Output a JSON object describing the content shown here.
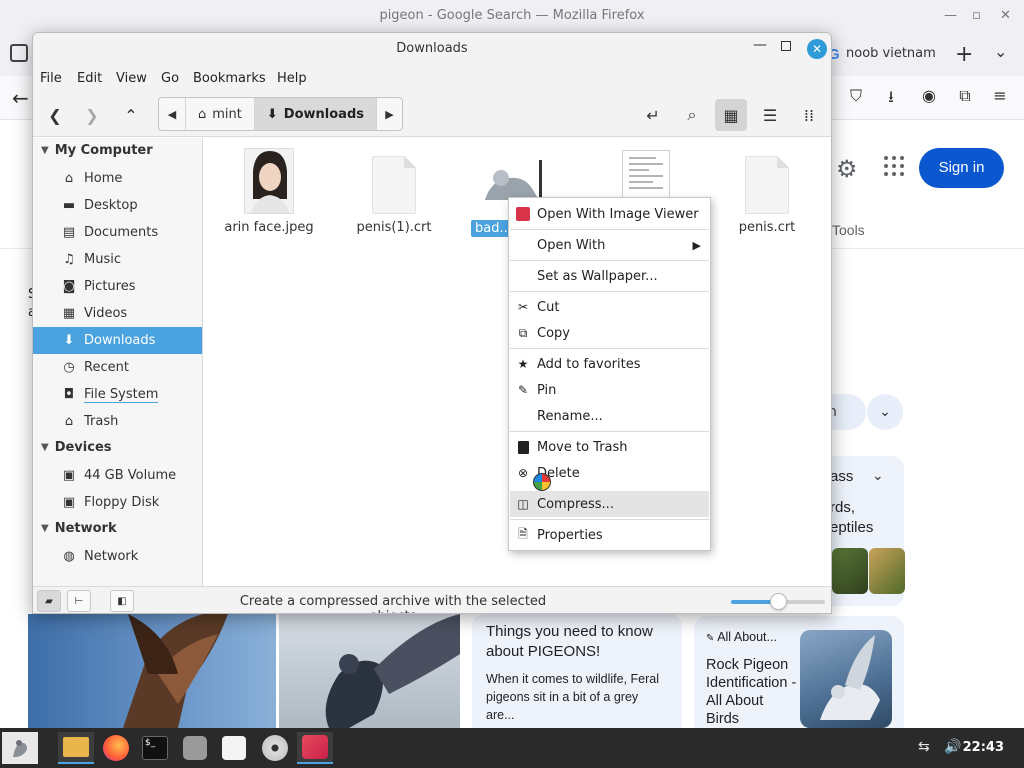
{
  "firefox": {
    "window_title": "pigeon - Google Search — Mozilla Firefox",
    "tab_label": "noob vietnam",
    "google": {
      "signin_label": "Sign in",
      "tools_label": "Tools",
      "chip_partial": "n",
      "panel_title_partial": "ass",
      "panel_text_partial_1": "rds,",
      "panel_text_partial_2": "eptiles",
      "left_partial_1": "S",
      "left_partial_2": "a",
      "card1_title": "Things you need to know about PIGEONS!",
      "card1_body": "When it comes to wildlife, Feral pigeons sit in a bit of a grey are...",
      "card2_source": "All About...",
      "card2_title": "Rock Pigeon Identification - All About Birds"
    }
  },
  "nemo": {
    "title": "Downloads",
    "menu": [
      "File",
      "Edit",
      "View",
      "Go",
      "Bookmarks",
      "Help"
    ],
    "path": {
      "home": "mint",
      "current": "Downloads"
    },
    "sidebar": {
      "sections": [
        {
          "header": "My Computer",
          "items": [
            {
              "label": "Home",
              "icon": "home-icon",
              "glyph": "⌂"
            },
            {
              "label": "Desktop",
              "icon": "desktop-icon",
              "glyph": "▬"
            },
            {
              "label": "Documents",
              "icon": "documents-icon",
              "glyph": "▤"
            },
            {
              "label": "Music",
              "icon": "music-icon",
              "glyph": "♫"
            },
            {
              "label": "Pictures",
              "icon": "camera-icon",
              "glyph": "◙"
            },
            {
              "label": "Videos",
              "icon": "film-icon",
              "glyph": "▦"
            },
            {
              "label": "Downloads",
              "icon": "download-icon",
              "glyph": "⬇"
            },
            {
              "label": "Recent",
              "icon": "clock-icon",
              "glyph": "◷"
            },
            {
              "label": "File System",
              "icon": "drive-icon",
              "glyph": "◘"
            },
            {
              "label": "Trash",
              "icon": "trash-icon",
              "glyph": "🗑"
            }
          ]
        },
        {
          "header": "Devices",
          "items": [
            {
              "label": "44 GB Volume",
              "icon": "disk-icon",
              "glyph": "▣"
            },
            {
              "label": "Floppy Disk",
              "icon": "floppy-icon",
              "glyph": "▣"
            }
          ]
        },
        {
          "header": "Network",
          "items": [
            {
              "label": "Network",
              "icon": "globe-icon",
              "glyph": "◍"
            }
          ]
        }
      ],
      "selected": "Downloads"
    },
    "files": [
      {
        "name": "arin face.jpeg",
        "kind": "image"
      },
      {
        "name": "penis(1).crt",
        "kind": "document"
      },
      {
        "name": "bad...",
        "kind": "image",
        "selected": true
      },
      {
        "name": "",
        "kind": "text"
      },
      {
        "name": "penis.crt",
        "kind": "document"
      }
    ],
    "status_text": "Create a compressed archive with the selected objects",
    "zoom_level": 0.5
  },
  "context_menu": {
    "items": [
      {
        "label": "Open With Image Viewer",
        "icon": "image-viewer-icon"
      },
      {
        "label": "Open With",
        "icon": "",
        "submenu": true
      },
      {
        "label": "Set as Wallpaper...",
        "icon": ""
      },
      {
        "label": "Cut",
        "icon": "scissors-icon"
      },
      {
        "label": "Copy",
        "icon": "copy-icon"
      },
      {
        "label": "Add to favorites",
        "icon": "star-icon"
      },
      {
        "label": "Pin",
        "icon": "pin-icon"
      },
      {
        "label": "Rename...",
        "icon": ""
      },
      {
        "label": "Move to Trash",
        "icon": "trash-icon"
      },
      {
        "label": "Delete",
        "icon": "delete-icon"
      },
      {
        "label": "Compress...",
        "icon": "archive-icon",
        "hover": true
      },
      {
        "label": "Properties",
        "icon": "properties-icon"
      }
    ]
  },
  "taskbar": {
    "clock": "22:43",
    "apps": [
      "menu",
      "files",
      "firefox",
      "terminal",
      "disks",
      "text-editor",
      "disc",
      "image-viewer"
    ]
  }
}
